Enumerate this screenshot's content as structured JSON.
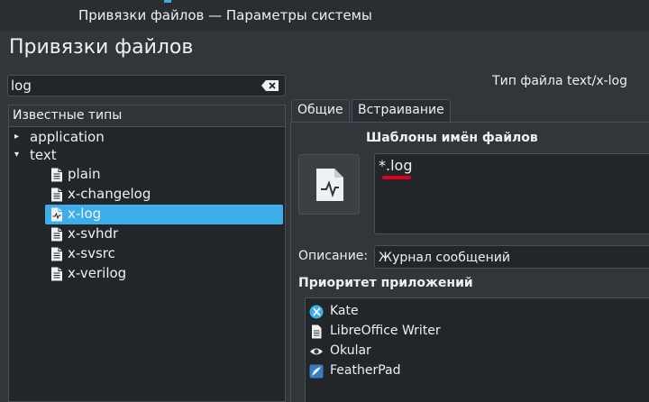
{
  "window": {
    "title": "Привязки файлов — Параметры системы"
  },
  "page": {
    "title": "Привязки файлов"
  },
  "search": {
    "value": "log"
  },
  "tree": {
    "header": "Известные типы",
    "groups": [
      {
        "label": "application",
        "expanded": false
      },
      {
        "label": "text",
        "expanded": true
      }
    ],
    "items": [
      {
        "label": "plain",
        "icon": "text-file-icon"
      },
      {
        "label": "x-changelog",
        "icon": "text-file-icon"
      },
      {
        "label": "x-log",
        "icon": "log-file-icon",
        "selected": true
      },
      {
        "label": "x-svhdr",
        "icon": "text-file-icon"
      },
      {
        "label": "x-svsrc",
        "icon": "text-file-icon"
      },
      {
        "label": "x-verilog",
        "icon": "text-file-icon"
      }
    ]
  },
  "details": {
    "file_type_title": "Тип файла text/x-log",
    "tabs": [
      {
        "label": "Общие",
        "active": true
      },
      {
        "label": "Встраивание",
        "active": false
      }
    ],
    "patterns_label": "Шаблоны имён файлов",
    "patterns": [
      "*.log"
    ],
    "description_label": "Описание:",
    "description_value": "Журнал сообщений",
    "app_priority_label": "Приоритет приложений",
    "apps": [
      {
        "label": "Kate",
        "icon": "kate-icon"
      },
      {
        "label": "LibreOffice Writer",
        "icon": "document-icon"
      },
      {
        "label": "Okular",
        "icon": "okular-eye-icon"
      },
      {
        "label": "FeatherPad",
        "icon": "featherpad-icon"
      }
    ]
  },
  "colors": {
    "background": "#31363b",
    "field": "#232629",
    "accent": "#3daee9",
    "annotation": "#e0001b"
  }
}
